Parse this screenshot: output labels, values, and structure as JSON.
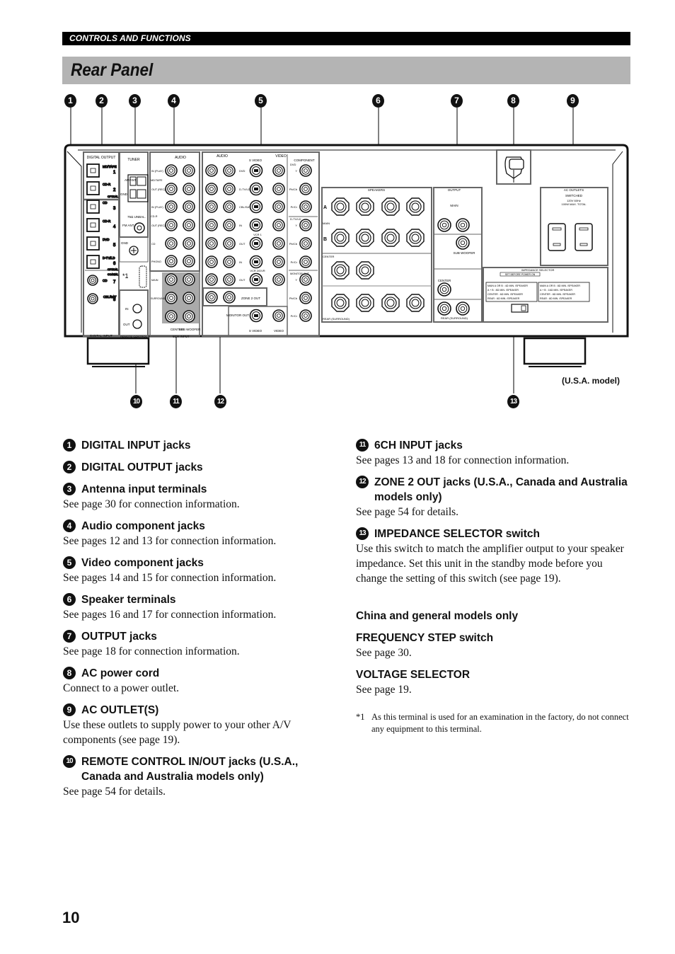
{
  "header": {
    "section": "CONTROLS AND FUNCTIONS",
    "title": "Rear Panel"
  },
  "diagram": {
    "model_note": "(U.S.A. model)",
    "top_callouts": [
      "1",
      "2",
      "3",
      "4",
      "5",
      "6",
      "7",
      "8",
      "9"
    ],
    "bottom_callouts": [
      "10",
      "11",
      "12",
      "13"
    ],
    "panel_labels": {
      "digital_output": "DIGITAL OUTPUT",
      "digital_input": "DIGITAL INPUT",
      "tuner": "TUNER",
      "am_ant": "AM ANT",
      "gnd": "GND",
      "fm_ant": "FM ANT",
      "unbal": "75Ω UNBAL.",
      "remote_control": "REMOTE CONTROL",
      "remote_in": "IN",
      "remote_out": "OUT",
      "factory_terminal": "*1",
      "audio": "AUDIO",
      "video": "VIDEO",
      "s_video": "S VIDEO",
      "component": "COMPONENT",
      "six_ch_input": "6CH INPUT",
      "zone2_out": "ZONE 2  OUT",
      "monitor_out": "MONITOR OUT",
      "speakers": "SPEAKERS",
      "speaker_a": "A",
      "speaker_b": "B",
      "speaker_main": "MAIN",
      "speaker_center": "CENTER",
      "speaker_rear": "REAR (SURROUND)",
      "output": "OUTPUT",
      "output_main": "MAIN",
      "output_sub": "SUB WOOFER",
      "output_center": "CENTER",
      "output_rear": "REAR (SURROUND)",
      "ac_outlets": "AC OUTLETS",
      "switched": "SWITCHED",
      "ac_rating_1": "120V 60Hz",
      "ac_rating_2": "100W MAX. TOTAL",
      "impedance_selector": "IMPEDANCE SELECTOR",
      "set_before": "SET BEFORE POWER ON",
      "imp_left": [
        "MAIN A OR B : 4Ω MIN. /SPEAKER",
        "A + B : 8Ω MIN. /SPEAKER",
        "CENTER : 6Ω MIN. /SPEAKER",
        "REAR : 6Ω MIN. /SPEAKER"
      ],
      "imp_right": [
        "MAIN A OR B : 8Ω MIN. /SPEAKER",
        "A + B : 16Ω MIN. /SPEAKER",
        "CENTER : 8Ω MIN. /SPEAKER",
        "REAR : 8Ω MIN. /SPEAKER"
      ],
      "digital_jacks": [
        "MD/TAPE",
        "CD-R",
        "CD",
        "CD-R",
        "DVD",
        "D-TV/LD",
        "CD",
        "CBL/SAT"
      ],
      "digital_nums": [
        "1",
        "2",
        "3",
        "4",
        "5",
        "6",
        "7",
        "8"
      ],
      "optical": "OPTICAL",
      "coaxial": "COAXIAL",
      "audio_rows": [
        "IN (PLAY)",
        "OUT (REC)",
        "IN (PLAY)",
        "OUT (REC)",
        "CD",
        "PHONO"
      ],
      "audio_groups": [
        "MD/TAPE",
        "CD-R"
      ],
      "six_ch_rows": [
        "MAIN",
        "SURROUND",
        "CENTER",
        "SUB WOOFER"
      ],
      "video_rows": [
        "DVD",
        "D-TV/LD",
        "CBL/SAT",
        "IN",
        "OUT",
        "IN",
        "OUT"
      ],
      "video_groups": [
        "VCR 1",
        "VCR 2/DVR"
      ],
      "component_groups": [
        "DVD",
        "D-TV/LD",
        "MONITOR OUT"
      ],
      "component_jacks": [
        "Y",
        "Pb/Cb",
        "Pr/Cr"
      ]
    }
  },
  "left_items": [
    {
      "num": "1",
      "title": "DIGITAL INPUT jacks",
      "body": ""
    },
    {
      "num": "2",
      "title": "DIGITAL OUTPUT jacks",
      "body": ""
    },
    {
      "num": "3",
      "title": "Antenna input terminals",
      "body": "See page 30 for connection information."
    },
    {
      "num": "4",
      "title": "Audio component jacks",
      "body": "See pages 12 and 13 for connection information."
    },
    {
      "num": "5",
      "title": "Video component jacks",
      "body": "See pages 14 and 15 for connection information."
    },
    {
      "num": "6",
      "title": "Speaker terminals",
      "body": "See pages 16 and 17 for connection information."
    },
    {
      "num": "7",
      "title": "OUTPUT jacks",
      "body": "See page 18 for connection information."
    },
    {
      "num": "8",
      "title": "AC power cord",
      "body": "Connect to a power outlet."
    },
    {
      "num": "9",
      "title": "AC OUTLET(S)",
      "body": "Use these outlets to supply power to your other A/V components (see page 19)."
    },
    {
      "num": "10",
      "title": "REMOTE CONTROL IN/OUT jacks (U.S.A., Canada and Australia models only)",
      "body": "See page 54 for details."
    }
  ],
  "right_items": [
    {
      "num": "11",
      "title": "6CH INPUT jacks",
      "body": "See pages 13 and 18 for connection information."
    },
    {
      "num": "12",
      "title": "ZONE 2 OUT jacks (U.S.A., Canada and Australia models only)",
      "body": "See page 54 for details."
    },
    {
      "num": "13",
      "title": "IMPEDANCE SELECTOR switch",
      "body": "Use this switch to match the amplifier output to your speaker impedance. Set this unit in the standby mode before you change the setting of this switch (see page 19)."
    }
  ],
  "china_section": {
    "heading": "China and general models only",
    "items": [
      {
        "title": "FREQUENCY STEP switch",
        "body": "See page 30."
      },
      {
        "title": "VOLTAGE SELECTOR",
        "body": "See page 19."
      }
    ]
  },
  "footnote": {
    "mark": "*1",
    "text": "As this terminal is used for an examination in the factory, do not connect any equipment to this terminal."
  },
  "page_number": "10"
}
